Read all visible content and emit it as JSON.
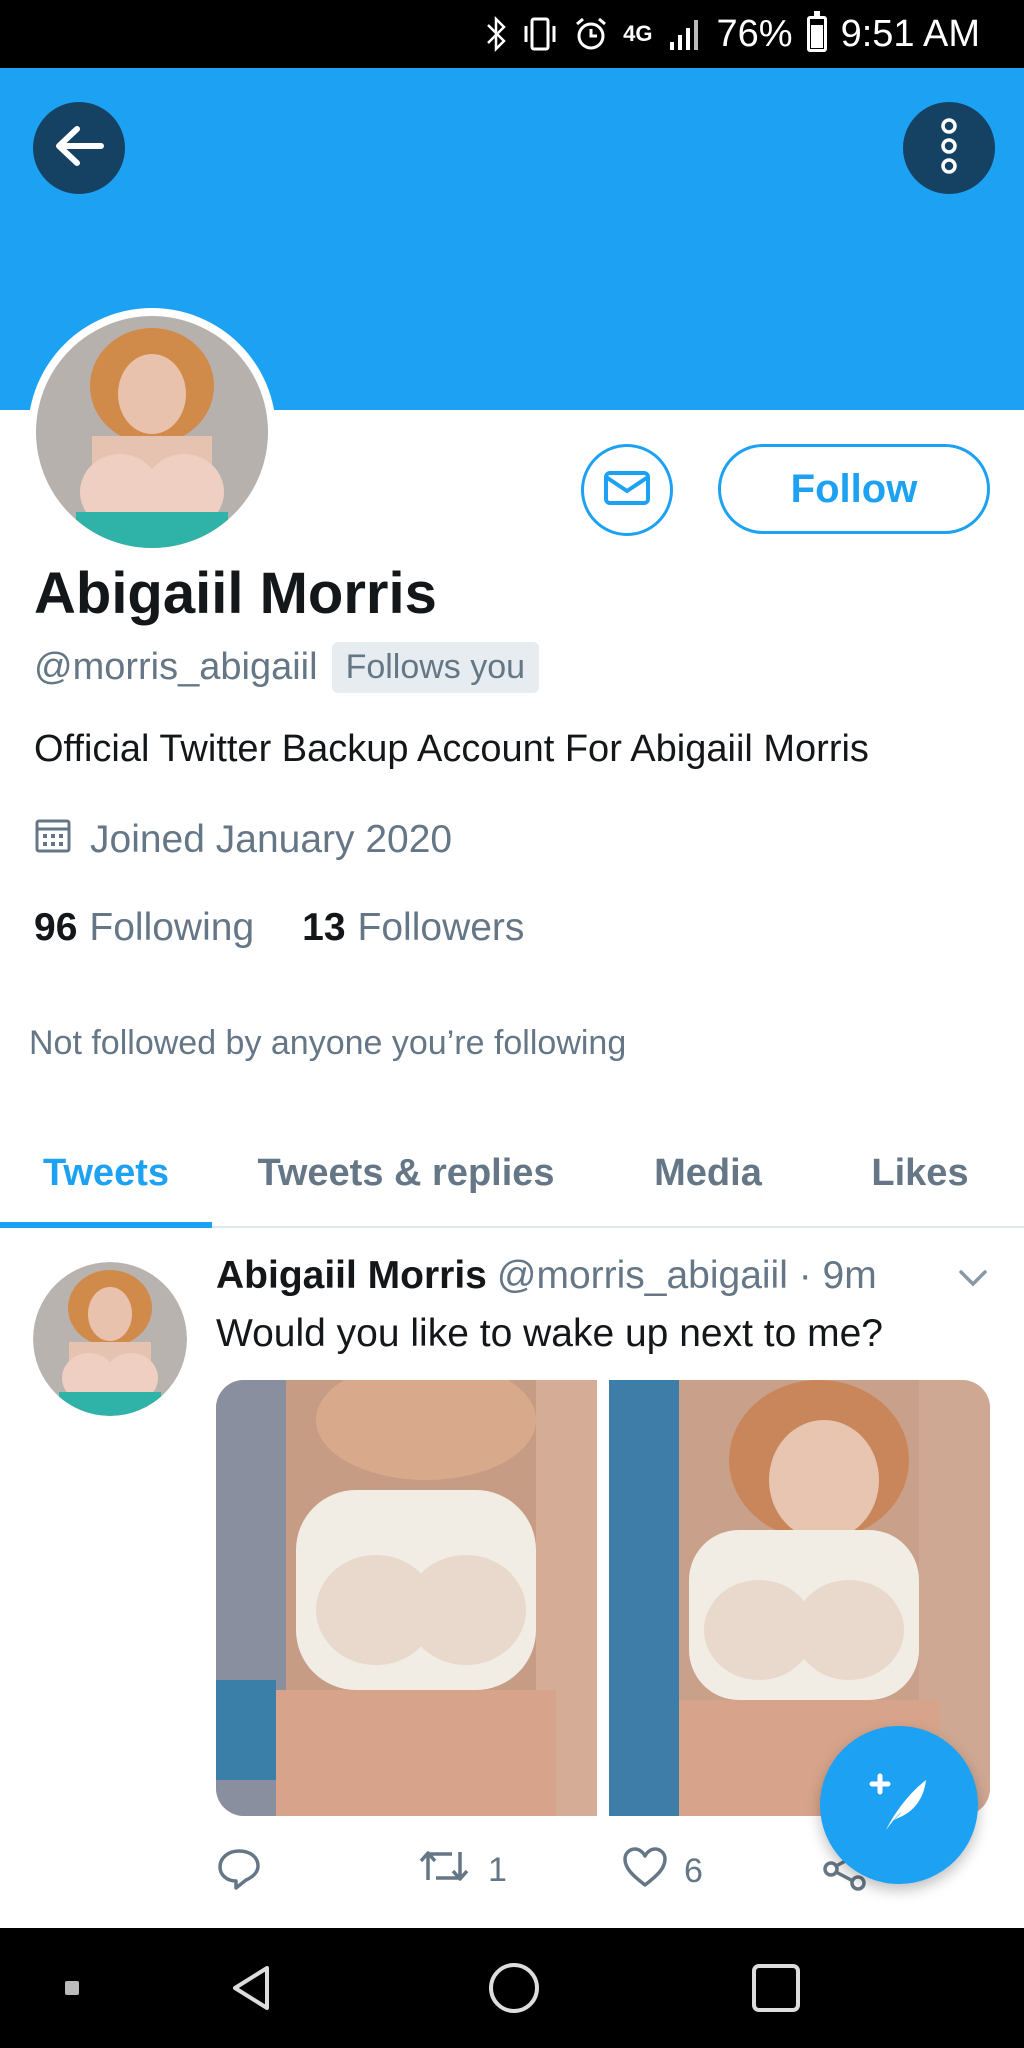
{
  "status_bar": {
    "network": "4G",
    "battery": "76%",
    "battery_level": 0.76,
    "time": "9:51 AM",
    "icons": [
      "bluetooth-icon",
      "vibrate-icon",
      "alarm-icon",
      "network-4g-icon",
      "signal-icon",
      "battery-icon"
    ]
  },
  "header": {
    "back_icon": "arrow-left-icon",
    "more_icon": "vertical-dots-icon",
    "banner_color": "#1da1f2"
  },
  "profile": {
    "name": "Abigaiil Morris",
    "handle": "@morris_abigaiil",
    "follows_you": "Follows you",
    "bio": "Official Twitter Backup Account For Abigaiil Morris",
    "joined": "Joined January 2020",
    "following_count": "96",
    "following_label": "Following",
    "followers_count": "13",
    "followers_label": "Followers",
    "not_followed": "Not followed by anyone you’re following",
    "follow_label": "Follow",
    "message_icon": "envelope-icon",
    "calendar_icon": "calendar-icon"
  },
  "tabs": [
    {
      "label": "Tweets",
      "active": true
    },
    {
      "label": "Tweets & replies",
      "active": false
    },
    {
      "label": "Media",
      "active": false
    },
    {
      "label": "Likes",
      "active": false
    }
  ],
  "tweet": {
    "author": "Abigaiil Morris",
    "meta": "@morris_abigaiil · 9m",
    "text": "Would you like to wake up next to me?",
    "media_count": 2,
    "reply_count": "",
    "retweet_count": "1",
    "like_count": "6"
  },
  "fab": {
    "icon": "compose-tweet-icon"
  },
  "nav_bar": {
    "icons": [
      "back-triangle-icon",
      "home-circle-icon",
      "recents-square-icon"
    ]
  },
  "colors": {
    "accent": "#1da1f2",
    "text": "#14171a",
    "secondary": "#657786",
    "divider": "#e1e8ed"
  }
}
